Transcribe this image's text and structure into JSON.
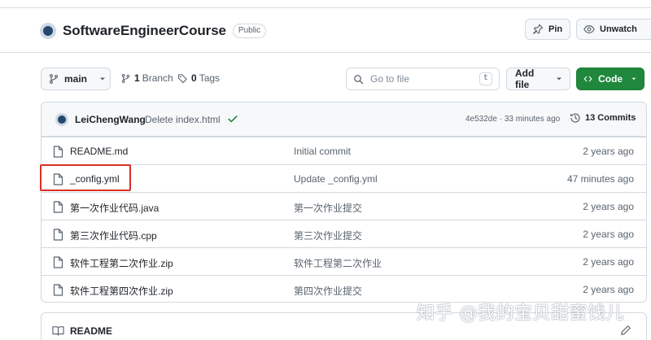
{
  "repo": {
    "name": "SoftwareEngineerCourse",
    "visibility": "Public"
  },
  "header_actions": {
    "pin_label": "Pin",
    "watch_label": "Unwatch"
  },
  "toolbar": {
    "branch": "main",
    "branch_count": "1",
    "branch_label": "Branch",
    "tag_count": "0",
    "tag_label": "Tags",
    "goto_placeholder": "Go to file",
    "goto_shortcut": "t",
    "add_file_label": "Add file",
    "code_label": "Code"
  },
  "latest_commit": {
    "author": "LeiChengWang",
    "message": "Delete index.html",
    "meta": "4e532de · 33 minutes ago",
    "commits_label": "13 Commits"
  },
  "files": [
    {
      "name": "README.md",
      "commit": "Initial commit",
      "age": "2 years ago"
    },
    {
      "name": "_config.yml",
      "commit": "Update _config.yml",
      "age": "47 minutes ago"
    },
    {
      "name": "第一次作业代码.java",
      "commit": "第一次作业提交",
      "age": "2 years ago"
    },
    {
      "name": "第三次作业代码.cpp",
      "commit": "第三次作业提交",
      "age": "2 years ago"
    },
    {
      "name": "软件工程第二次作业.zip",
      "commit": "软件工程第二次作业",
      "age": "2 years ago"
    },
    {
      "name": "软件工程第四次作业.zip",
      "commit": "第四次作业提交",
      "age": "2 years ago"
    }
  ],
  "readme": {
    "title": "README"
  },
  "watermark": "知乎 @我的宝贝甜蜜饯儿",
  "colors": {
    "accent_green": "#1f883d",
    "highlight_red": "#d93025"
  },
  "icons": [
    "pin-icon",
    "eye-icon",
    "branch-icon",
    "tag-icon",
    "search-icon",
    "code-icon",
    "history-icon",
    "check-icon",
    "file-icon",
    "book-icon",
    "pencil-icon",
    "chevron-down-icon"
  ]
}
